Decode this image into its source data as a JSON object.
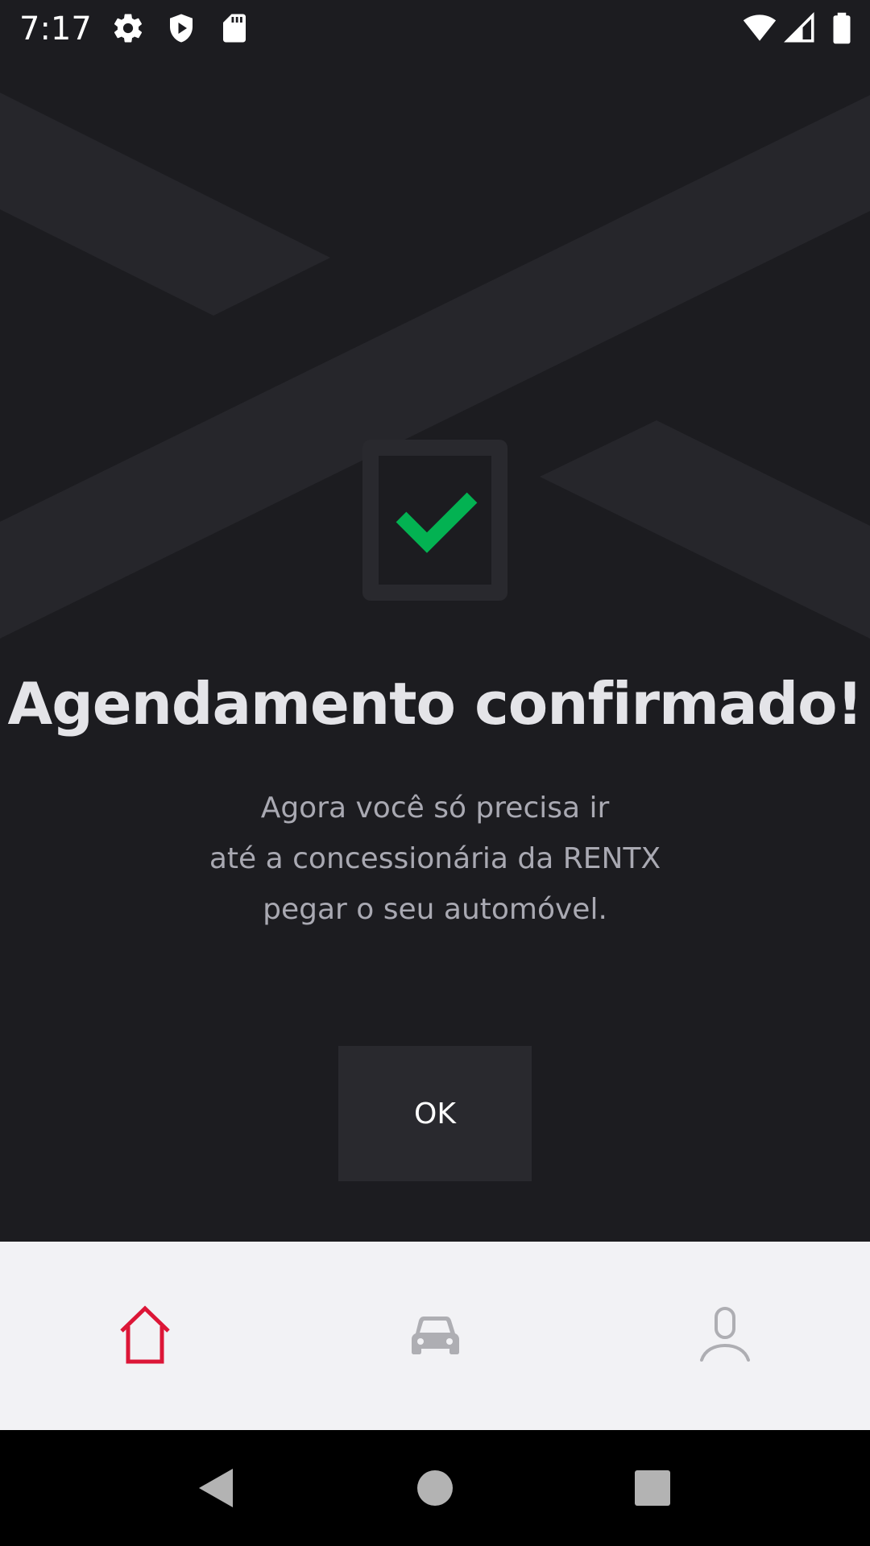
{
  "status_bar": {
    "time": "7:17",
    "left_icons": [
      "gear-icon",
      "shield-play-icon",
      "sd-card-icon"
    ],
    "right_icons": [
      "wifi-icon",
      "signal-icon",
      "battery-icon"
    ]
  },
  "confirmation": {
    "icon": "checkmark-icon",
    "title": "Agendamento confirmado!",
    "message_lines": [
      "Agora você só precisa ir",
      "até a concessionária da RENTX",
      "pegar o seu automóvel."
    ],
    "ok_label": "OK"
  },
  "tab_bar": {
    "tabs": [
      {
        "name": "home",
        "icon": "home-icon",
        "active": true
      },
      {
        "name": "cars",
        "icon": "car-icon",
        "active": false
      },
      {
        "name": "profile",
        "icon": "user-icon",
        "active": false
      }
    ]
  },
  "nav_bar": {
    "buttons": [
      "back-icon",
      "home-circle-icon",
      "recents-icon"
    ]
  },
  "colors": {
    "background": "#1c1c20",
    "accent_red": "#dc1637",
    "success_green": "#03b252",
    "title_text": "#e4e4e8",
    "body_text": "#a9a9b2",
    "button_bg": "#29292e",
    "tab_bar_bg": "#f2f2f5"
  }
}
